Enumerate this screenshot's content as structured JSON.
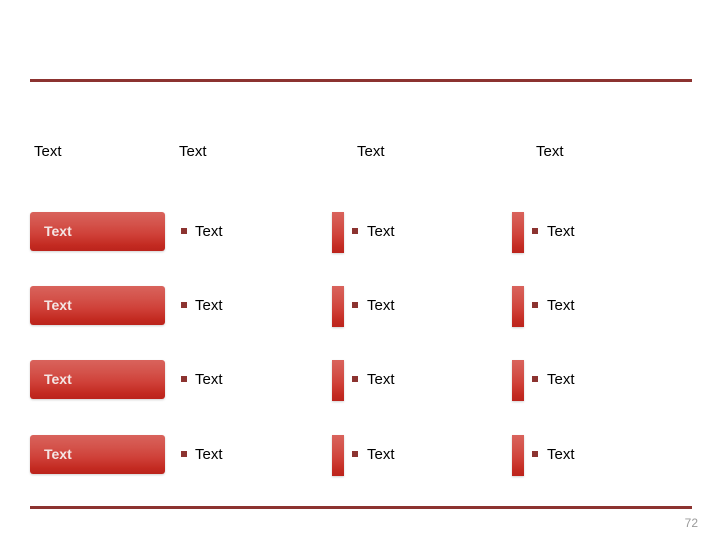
{
  "slide": {
    "page_number": "72",
    "accent_color": "#8c3330",
    "button_gradient_top": "#d9635c",
    "button_gradient_bottom": "#bb241c",
    "bullet_color": "#8c3330",
    "page_number_color": "#9a9a9a"
  },
  "header": {
    "columns": [
      {
        "label": "Text"
      },
      {
        "label": "Text"
      },
      {
        "label": "Text"
      },
      {
        "label": "Text"
      }
    ]
  },
  "rows": [
    {
      "col1": {
        "label": "Text"
      },
      "col2": {
        "label": "Text"
      },
      "col3": {
        "label": "Text"
      },
      "col4": {
        "label": "Text"
      }
    },
    {
      "col1": {
        "label": "Text"
      },
      "col2": {
        "label": "Text"
      },
      "col3": {
        "label": "Text"
      },
      "col4": {
        "label": "Text"
      }
    },
    {
      "col1": {
        "label": "Text"
      },
      "col2": {
        "label": "Text"
      },
      "col3": {
        "label": "Text"
      },
      "col4": {
        "label": "Text"
      }
    },
    {
      "col1": {
        "label": "Text"
      },
      "col2": {
        "label": "Text"
      },
      "col3": {
        "label": "Text"
      },
      "col4": {
        "label": "Text"
      }
    }
  ]
}
